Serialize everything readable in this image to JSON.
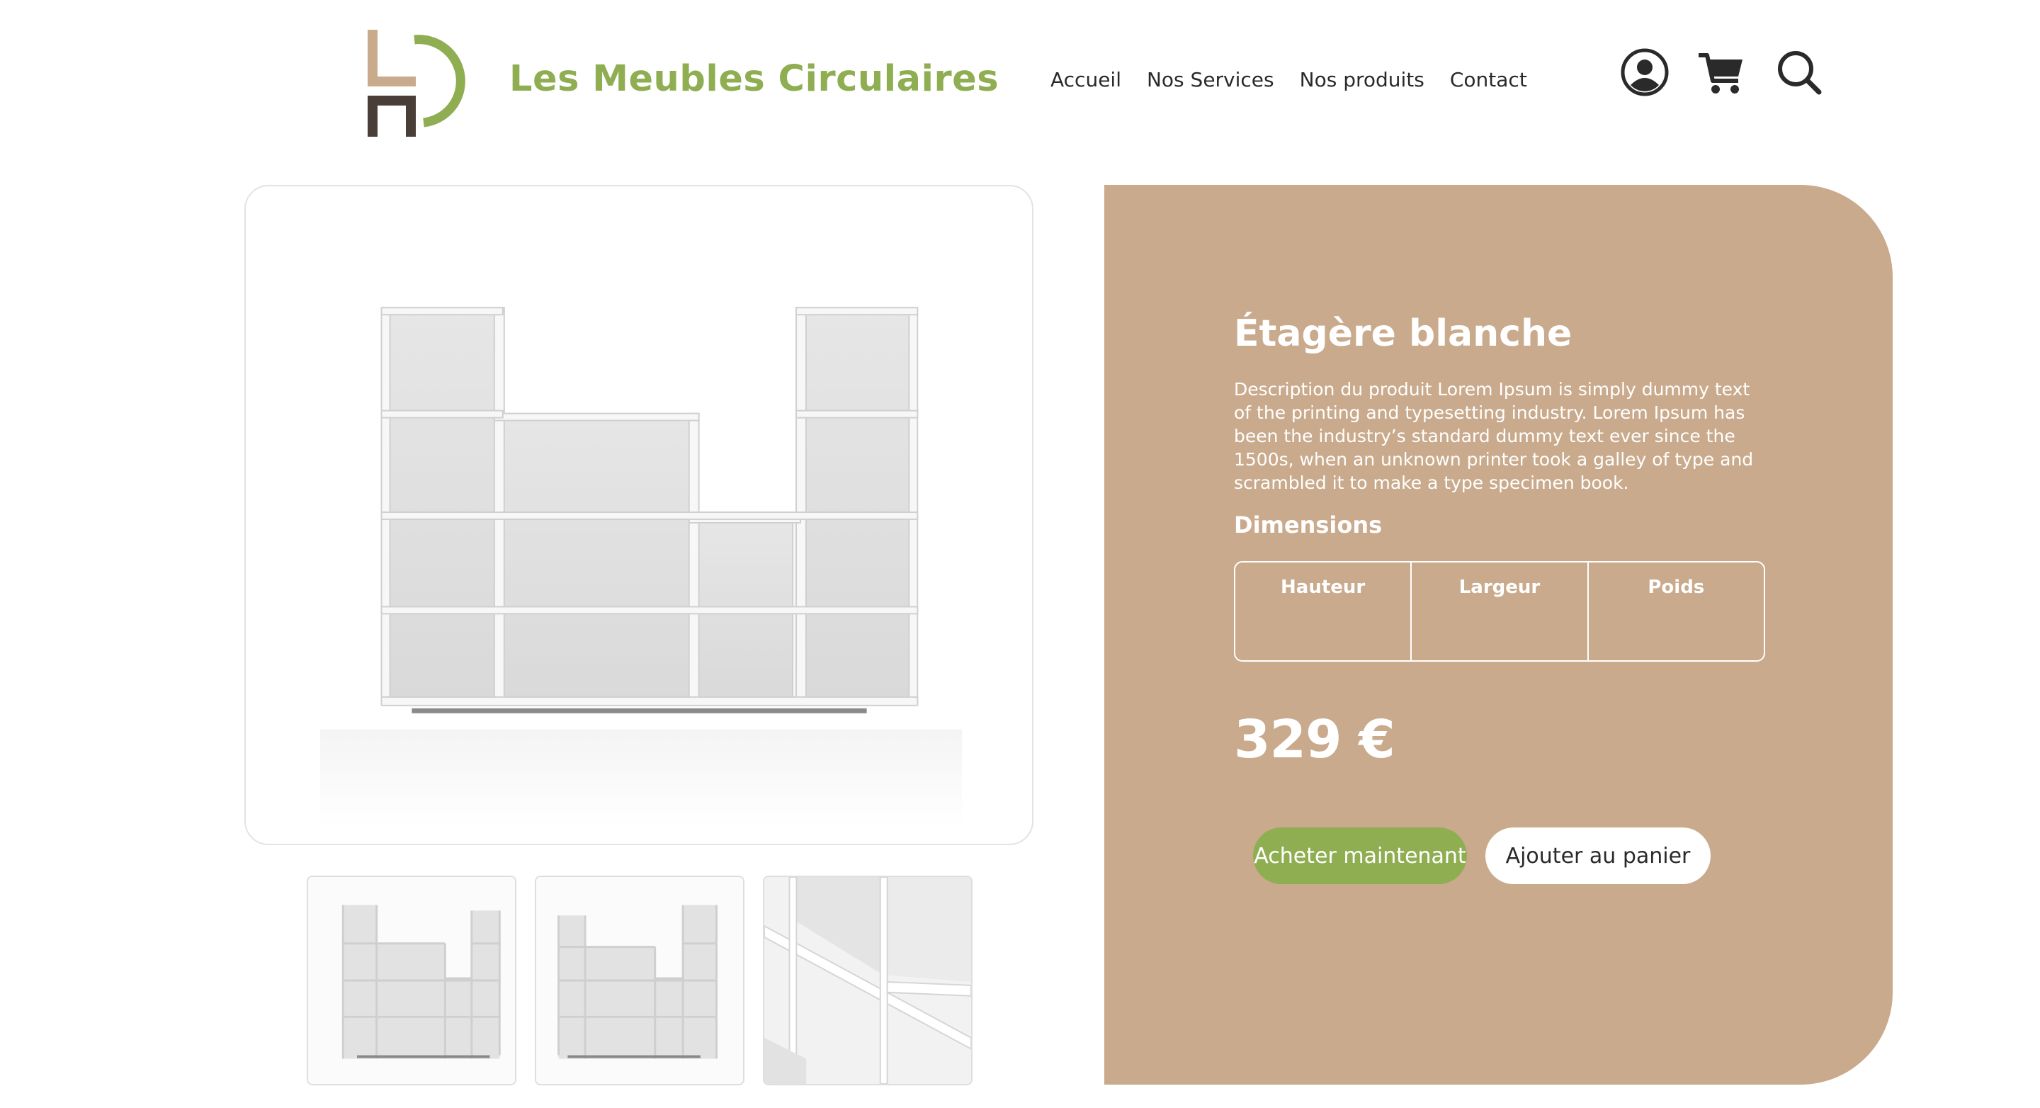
{
  "header": {
    "brand_name": "Les Meubles Circulaires",
    "nav": [
      "Accueil",
      "Nos Services",
      "Nos produits",
      "Contact"
    ],
    "icons": [
      "user-icon",
      "cart-icon",
      "search-icon"
    ]
  },
  "product": {
    "title": "Étagère blanche",
    "description": "Description du produit Lorem Ipsum is simply dummy text of the printing and typesetting industry. Lorem Ipsum has been the industry’s standard dummy text ever since the 1500s, when an unknown printer took a galley of type and scrambled it to make a type specimen book.",
    "dimensions_title": "Dimensions",
    "dimensions_headers": [
      "Hauteur",
      "Largeur",
      "Poids"
    ],
    "price": "329 €",
    "buy_label": "Acheter maintenant",
    "cart_label": "Ajouter au panier"
  },
  "colors": {
    "brand_green": "#8fae52",
    "panel_tan": "#c9aa8c",
    "logo_tan": "#c9aa8c",
    "logo_dark": "#4a3f38"
  }
}
